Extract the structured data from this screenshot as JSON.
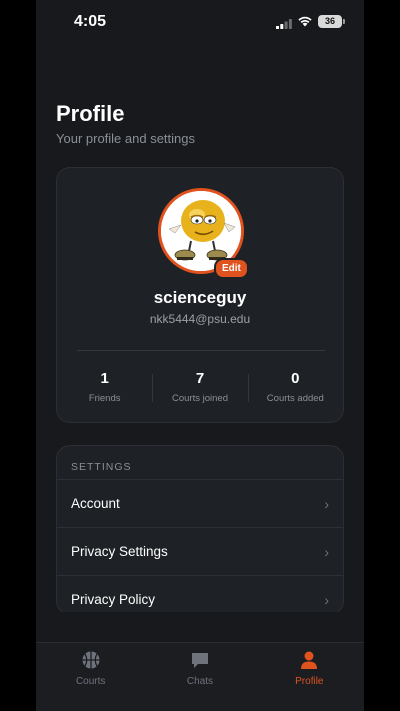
{
  "status_bar": {
    "time": "4:05",
    "battery": "36"
  },
  "header": {
    "title": "Profile",
    "subtitle": "Your profile and settings"
  },
  "profile": {
    "username": "scienceguy",
    "email": "nkk5444@psu.edu",
    "edit_label": "Edit",
    "stats": [
      {
        "value": "1",
        "label": "Friends"
      },
      {
        "value": "7",
        "label": "Courts joined"
      },
      {
        "value": "0",
        "label": "Courts added"
      }
    ]
  },
  "settings": {
    "header": "SETTINGS",
    "items": [
      {
        "label": "Account"
      },
      {
        "label": "Privacy Settings"
      },
      {
        "label": "Privacy Policy"
      }
    ]
  },
  "tab_bar": {
    "tabs": [
      {
        "label": "Courts",
        "icon": "basketball-icon",
        "active": false
      },
      {
        "label": "Chats",
        "icon": "chat-bubble-icon",
        "active": false
      },
      {
        "label": "Profile",
        "icon": "person-icon",
        "active": true
      }
    ]
  },
  "colors": {
    "accent": "#e0531e",
    "background": "#17191d",
    "card": "#1e2126"
  }
}
